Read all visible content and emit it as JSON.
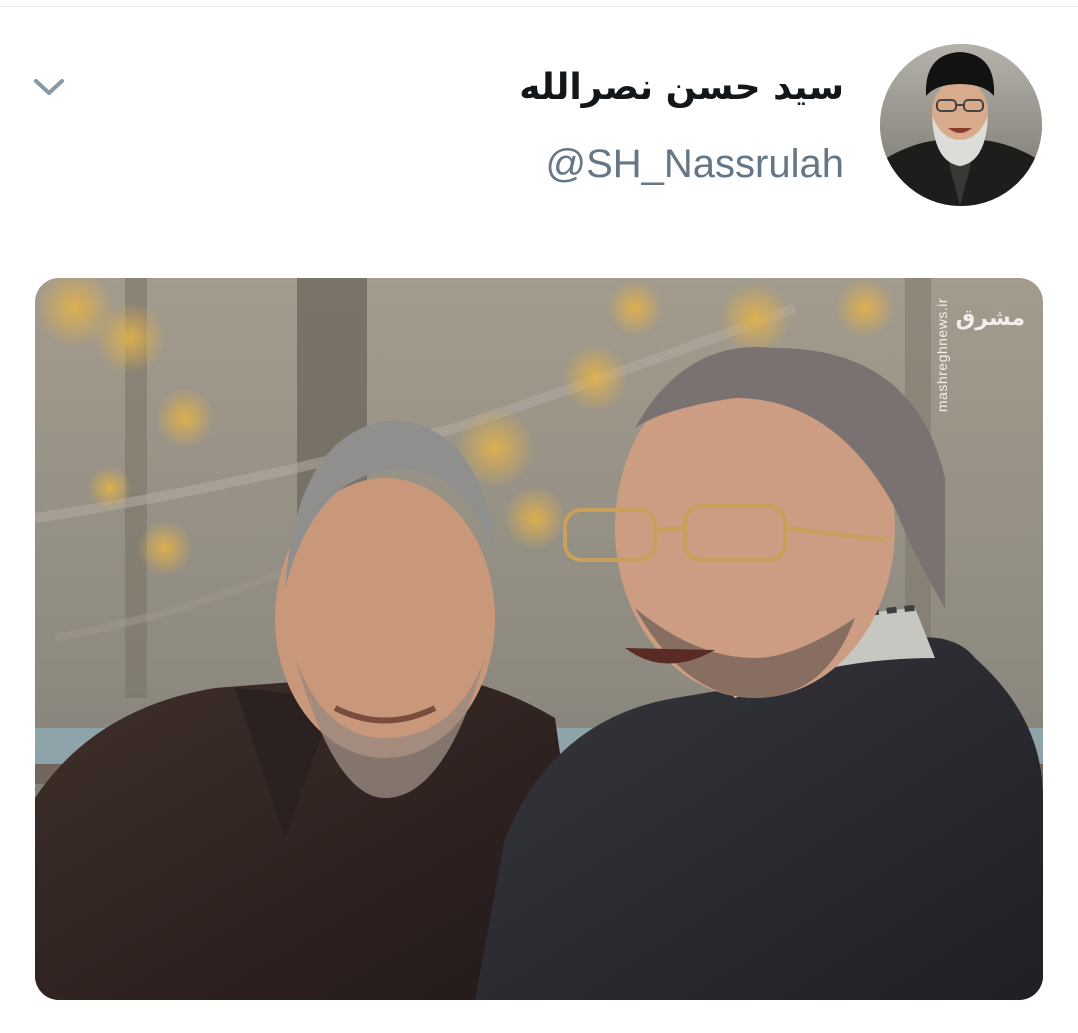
{
  "tweet": {
    "display_name": "سید حسن نصرالله",
    "handle": "@SH_Nassrulah",
    "menu_icon": "chevron-down-icon"
  },
  "media": {
    "watermark_logo": "مشرق",
    "watermark_url": "mashreghnews.ir"
  },
  "colors": {
    "name_text": "#14171a",
    "handle_text": "#657786",
    "chevron": "#8899a6",
    "divider": "#e6ecf0"
  }
}
